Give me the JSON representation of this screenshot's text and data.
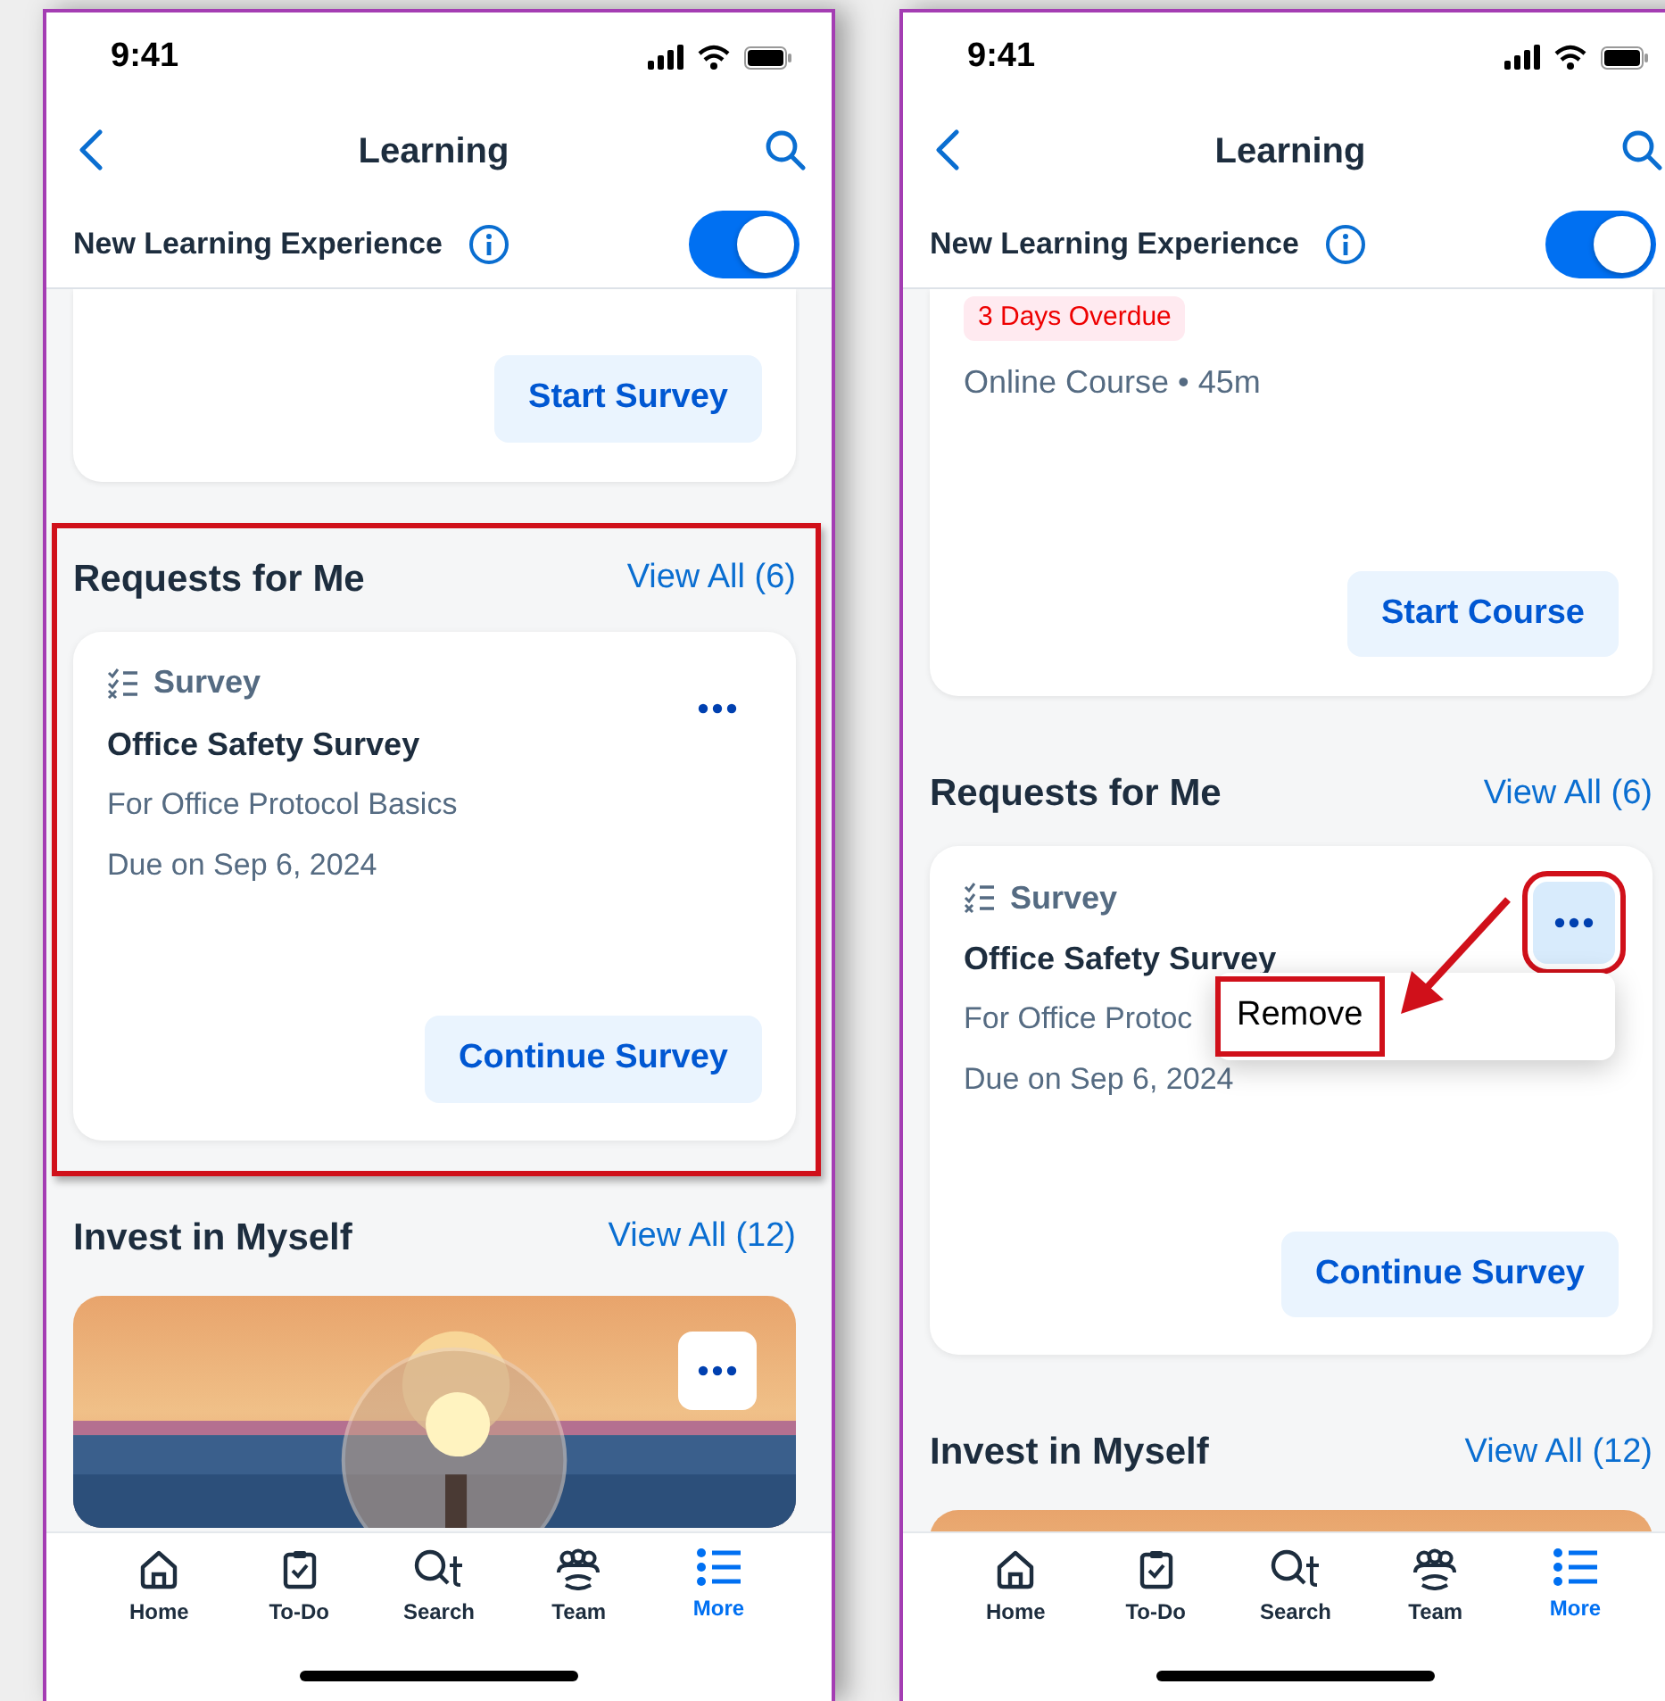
{
  "phones": [
    {
      "status_bar": {
        "time": "9:41"
      },
      "header": {
        "title": "Learning"
      },
      "toggle_row": {
        "label": "New Learning Experience",
        "on": true
      },
      "top_card": {
        "button": "Start Survey"
      },
      "requests": {
        "title": "Requests for Me",
        "view_all": "View All (6)",
        "highlighted": true,
        "card": {
          "type": "Survey",
          "title": "Office Safety Survey",
          "subtitle": "For Office Protocol Basics",
          "due": "Due on Sep 6, 2024",
          "button": "Continue Survey",
          "more_highlighted": false,
          "arrow": false
        }
      },
      "invest": {
        "title": "Invest in Myself",
        "view_all": "View All (12)",
        "card": {
          "kind": "picture",
          "more_button": true
        }
      },
      "tabs": [
        {
          "label": "Home",
          "selected": false
        },
        {
          "label": "To-Do",
          "selected": false
        },
        {
          "label": "Search",
          "selected": false
        },
        {
          "label": "Team",
          "selected": false
        },
        {
          "label": "More",
          "selected": true
        }
      ]
    },
    {
      "status_bar": {
        "time": "9:41"
      },
      "header": {
        "title": "Learning"
      },
      "toggle_row": {
        "label": "New Learning Experience",
        "on": true
      },
      "top_card": {
        "badge": "3 Days Overdue",
        "meta": "Online Course • 45m",
        "button": "Start Course"
      },
      "requests": {
        "title": "Requests for Me",
        "view_all": "View All (6)",
        "highlighted": false,
        "card": {
          "type": "Survey",
          "title": "Office Safety Survey",
          "subtitle": "For Office Protoc",
          "due": "Due on Sep 6, 2024",
          "button": "Continue Survey",
          "more_highlighted": true,
          "arrow": true,
          "menu": {
            "items": [
              {
                "label": "Remove",
                "highlighted": true
              }
            ]
          }
        }
      },
      "invest": {
        "title": "Invest in Myself",
        "view_all": "View All (12)",
        "card": {
          "kind": "picture"
        }
      },
      "tabs": [
        {
          "label": "Home",
          "selected": false
        },
        {
          "label": "To-Do",
          "selected": false
        },
        {
          "label": "Search",
          "selected": false
        },
        {
          "label": "Team",
          "selected": false
        },
        {
          "label": "More",
          "selected": true
        }
      ]
    }
  ]
}
